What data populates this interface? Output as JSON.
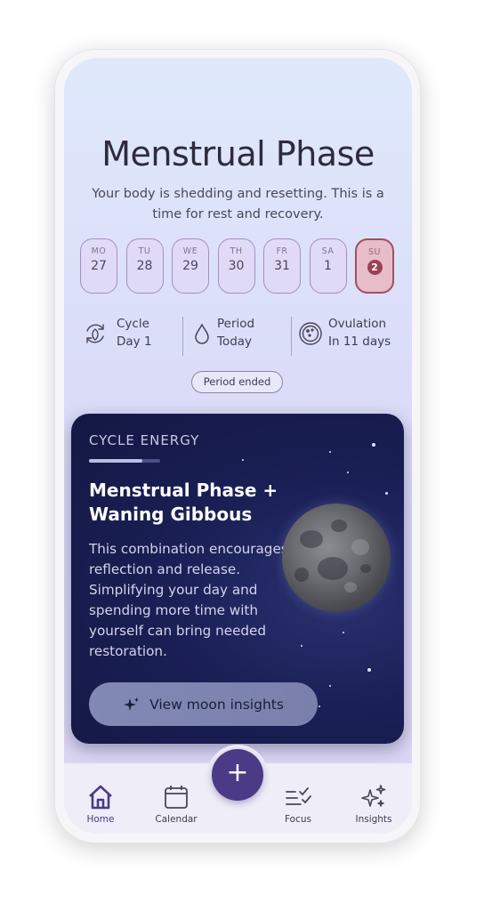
{
  "header": {
    "title": "Menstrual Phase",
    "description": "Your body is shedding and resetting. This is a time for rest and recovery."
  },
  "week": [
    {
      "day": "MO",
      "date": "27",
      "today": false
    },
    {
      "day": "TU",
      "date": "28",
      "today": false
    },
    {
      "day": "WE",
      "date": "29",
      "today": false
    },
    {
      "day": "TH",
      "date": "30",
      "today": false
    },
    {
      "day": "FR",
      "date": "31",
      "today": false
    },
    {
      "day": "SA",
      "date": "1",
      "today": false
    },
    {
      "day": "SU",
      "date": "2",
      "today": true
    }
  ],
  "stats": {
    "cycle": {
      "line1": "Cycle",
      "line2": "Day 1",
      "icon": "cycle-icon"
    },
    "period": {
      "line1": "Period",
      "line2": "Today",
      "icon": "drop-icon"
    },
    "ovulation": {
      "line1": "Ovulation",
      "line2": "In 11 days",
      "icon": "ovulation-icon"
    }
  },
  "period_status": "Period ended",
  "energy_card": {
    "eyebrow": "CYCLE ENERGY",
    "progress": 0.75,
    "title": "Menstrual Phase + Waning Gibbous",
    "body": "This combination encourages reflection and release. Simplifying your day and spending more time with yourself can bring needed restoration.",
    "cta": "View moon insights",
    "cta_icon": "sparkle-icon"
  },
  "tabs": [
    {
      "label": "Home",
      "icon": "home-icon",
      "active": true
    },
    {
      "label": "Calendar",
      "icon": "calendar-icon",
      "active": false
    },
    {
      "label": "Focus",
      "icon": "focus-icon",
      "active": false
    },
    {
      "label": "Insights",
      "icon": "insights-icon",
      "active": false
    }
  ],
  "fab": {
    "label": "+"
  },
  "colors": {
    "accent": "#4b3a86",
    "today_border": "#a1505f",
    "today_dot": "#9b4055",
    "card_bg": "#1a1f55"
  }
}
